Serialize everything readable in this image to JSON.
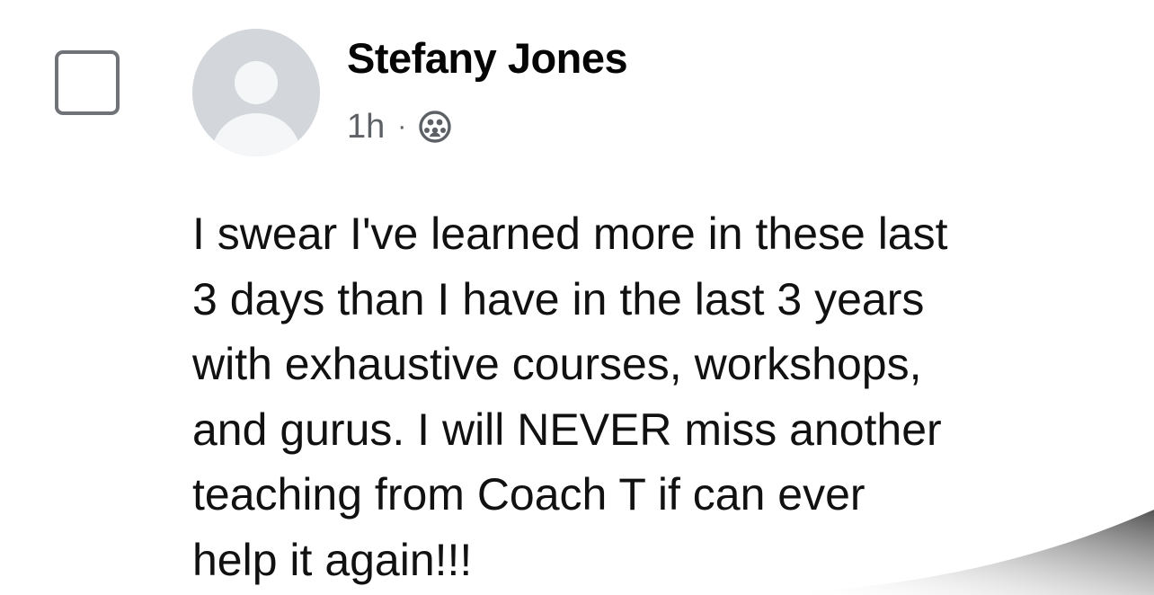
{
  "post": {
    "author": {
      "name": "Stefany Jones",
      "avatar_icon": "default-profile-silhouette"
    },
    "meta": {
      "time": "1h",
      "separator": "·",
      "audience_icon": "group-members-icon"
    },
    "body_lines": [
      "I swear I've learned more in these last",
      "3 days than I have in the last 3 years",
      "with exhaustive courses, workshops,",
      "and gurus. I will NEVER miss another",
      "teaching from Coach T if can ever",
      "help it again!!!"
    ]
  },
  "colors": {
    "name_text": "#050505",
    "meta_text": "#5d6166",
    "body_text": "#111111",
    "checkbox_border": "#6f7378",
    "avatar_background": "#d3d6db",
    "avatar_silhouette": "#f5f6f7"
  }
}
